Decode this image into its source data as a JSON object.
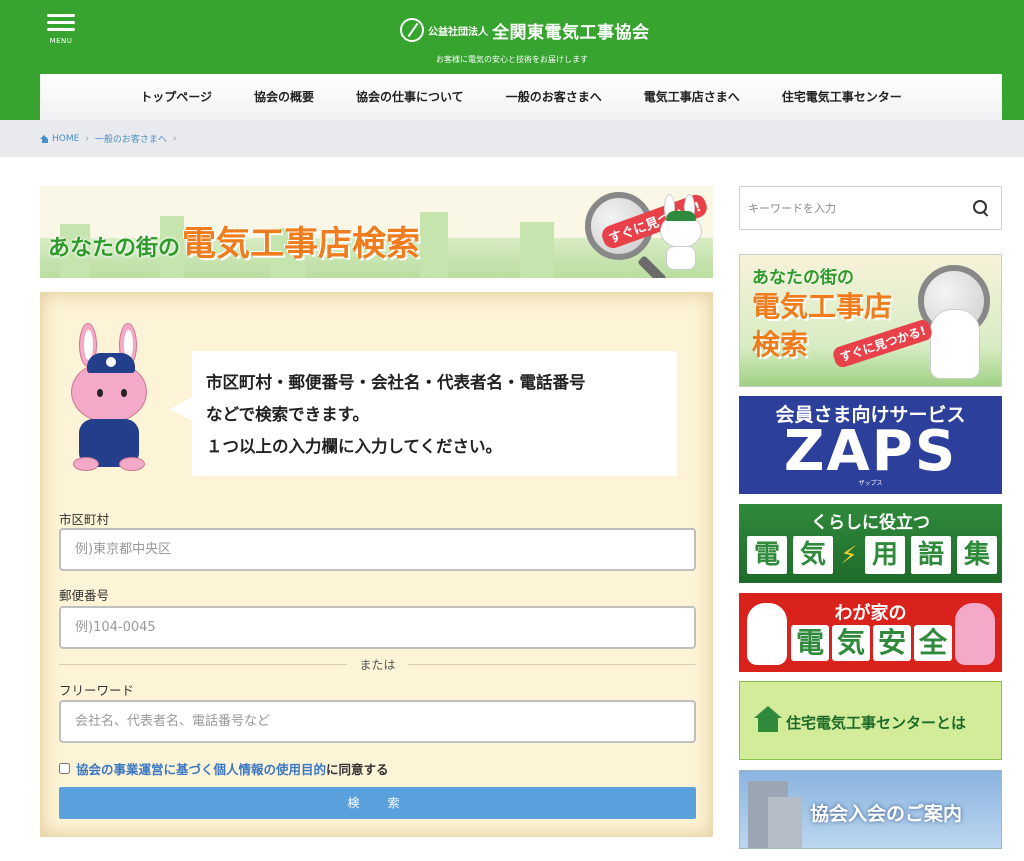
{
  "header": {
    "menu_label": "MENU",
    "logo_small": "公益社団法人",
    "logo_name": "全関東電気工事協会",
    "tagline": "お客様に電気の安心と技術をお届けします"
  },
  "nav": {
    "items": [
      {
        "label": "トップページ"
      },
      {
        "label": "協会の概要"
      },
      {
        "label": "協会の仕事について"
      },
      {
        "label": "一般のお客さまへ"
      },
      {
        "label": "電気工事店さまへ"
      },
      {
        "label": "住宅電気工事センター"
      }
    ]
  },
  "breadcrumb": {
    "home": "HOME",
    "current": "一般のお客さまへ"
  },
  "banner": {
    "small": "あなたの街の",
    "big": "電気工事店検索",
    "badge": "すぐに見つかる!"
  },
  "bubble": {
    "line1": "市区町村・郵便番号・会社名・代表者名・電話番号",
    "line2": "などで検索できます。",
    "line3": "１つ以上の入力欄に入力してください。"
  },
  "form": {
    "city_label": "市区町村",
    "city_placeholder": "例)東京都中央区",
    "zip_label": "郵便番号",
    "zip_placeholder": "例)104-0045",
    "or_text": "または",
    "free_label": "フリーワード",
    "free_placeholder": "会社名、代表者名、電話番号など",
    "agree_link": "協会の事業運営に基づく個人情報の使用目的",
    "agree_rest": "に同意する",
    "submit": "検　索"
  },
  "sidebar": {
    "search_placeholder": "キーワードを入力",
    "banner1": {
      "l1": "あなたの街の",
      "l2": "電気工事店",
      "l3": "検索",
      "tag": "すぐに見つかる!"
    },
    "banner2": {
      "t1": "会員さま向けサービス",
      "t2": "ZAPS",
      "t3": "ザップス"
    },
    "banner3": {
      "t1": "くらしに役立つ",
      "c1": "電",
      "c2": "気",
      "c3": "用",
      "c4": "語",
      "c5": "集"
    },
    "banner4": {
      "t1": "わが家の",
      "c1": "電",
      "c2": "気",
      "c3": "安",
      "c4": "全"
    },
    "banner5": {
      "t1": "住宅電気工事センターとは"
    },
    "banner6": {
      "t1": "協会入会のご案内"
    }
  },
  "colors": {
    "header_green": "#36a42f",
    "button_blue": "#5aa0dc",
    "link_blue": "#3b78c4",
    "form_bg": "#fdf3d6",
    "banner_orange": "#ef7d1d"
  }
}
